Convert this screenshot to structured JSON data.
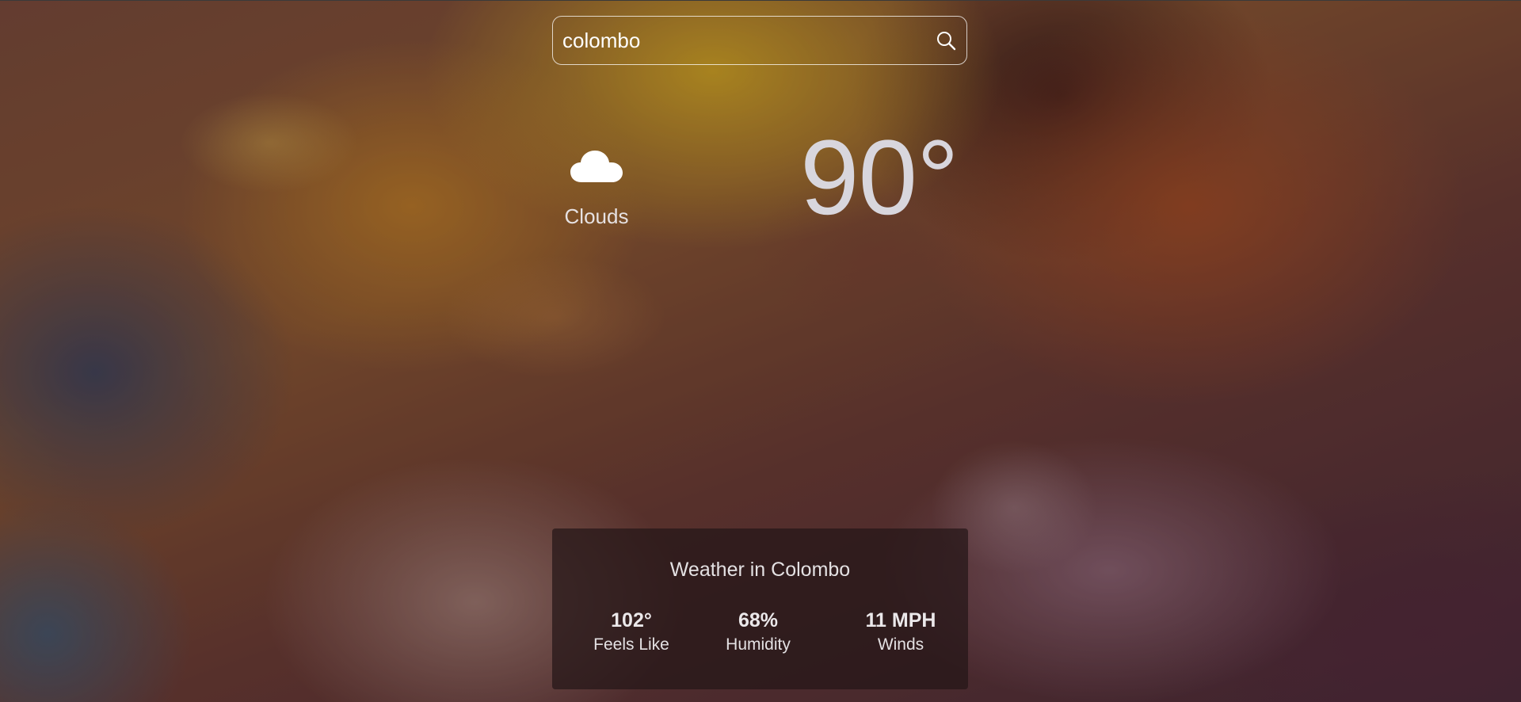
{
  "search": {
    "value": "colombo",
    "icon": "search-icon"
  },
  "current": {
    "icon": "cloud-icon",
    "condition": "Clouds",
    "temperature": "90°"
  },
  "details": {
    "title": "Weather in Colombo",
    "stats": [
      {
        "value": "102°",
        "label": "Feels Like"
      },
      {
        "value": "68%",
        "label": "Humidity"
      },
      {
        "value": "11 MPH",
        "label": "Winds"
      }
    ]
  },
  "colors": {
    "text": "#ffffff",
    "card_background": "rgba(36, 22, 24, 0.72)",
    "search_border": "#ffffff"
  }
}
